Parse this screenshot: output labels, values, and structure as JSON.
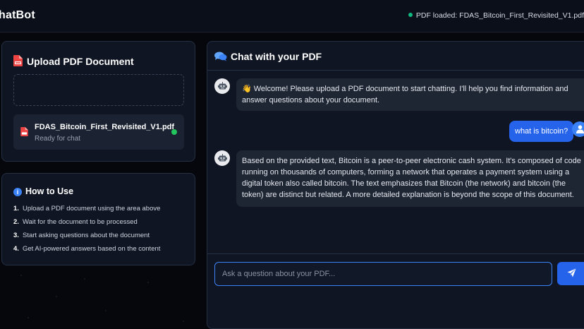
{
  "header": {
    "brand": "hatBot",
    "pdf_status": "PDF loaded: FDAS_Bitcoin_First_Revisited_V1.pdf",
    "status_color": "#10b981"
  },
  "upload": {
    "title": "Upload PDF Document",
    "file": {
      "name": "FDAS_Bitcoin_First_Revisited_V1.pdf",
      "status": "Ready for chat"
    }
  },
  "howto": {
    "title": "How to Use",
    "steps": [
      {
        "num": "1.",
        "text": "Upload a PDF document using the area above"
      },
      {
        "num": "2.",
        "text": "Wait for the document to be processed"
      },
      {
        "num": "3.",
        "text": "Start asking questions about the document"
      },
      {
        "num": "4.",
        "text": "Get AI-powered answers based on the content"
      }
    ]
  },
  "chat": {
    "title": "Chat with your PDF",
    "messages": [
      {
        "role": "bot",
        "text": "👋 Welcome! Please upload a PDF document to start chatting. I'll help you find information and answer questions about your document."
      },
      {
        "role": "user",
        "text": "what is bitcoin?"
      },
      {
        "role": "bot",
        "text": "Based on the provided text, Bitcoin is a peer-to-peer electronic cash system.  It's composed of code running on thousands of computers, forming a network that operates a payment system using a digital token also called bitcoin.  The text emphasizes that Bitcoin (the network) and bitcoin (the token) are distinct but related.  A more detailed explanation is beyond the scope of this document."
      }
    ],
    "input_placeholder": "Ask a question about your PDF...",
    "input_value": ""
  },
  "colors": {
    "accent": "#2563eb",
    "ready": "#22c55e",
    "pdf_icon": "#ef4444"
  },
  "icons": {
    "upload_title": "file-pdf-icon",
    "file": "file-pdf-icon",
    "howto": "info-icon",
    "chat": "comments-icon",
    "bot": "robot-icon",
    "user": "user-icon",
    "send": "paper-plane-icon"
  }
}
